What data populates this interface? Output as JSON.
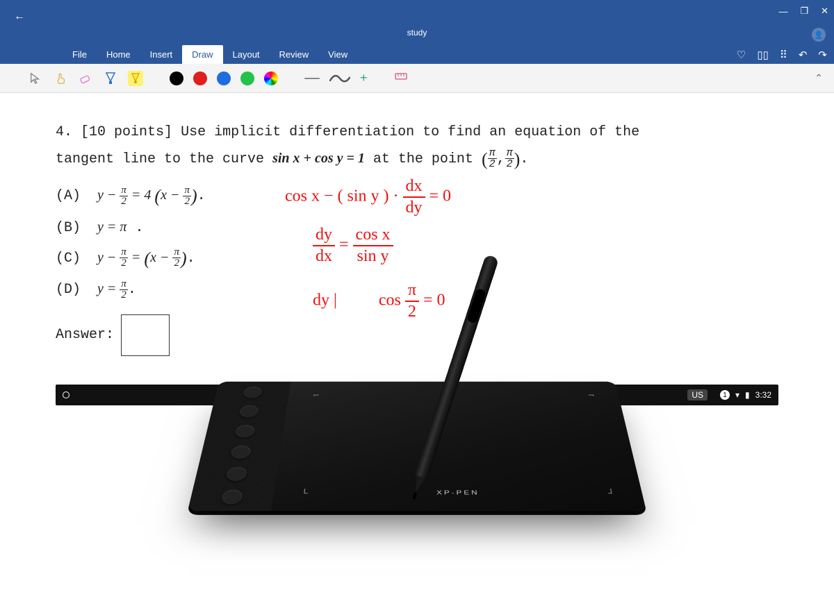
{
  "titlebar": {
    "doc_title": "study",
    "win": {
      "minimize": "—",
      "maximize": "❐",
      "close": "✕"
    }
  },
  "tabs": {
    "items": [
      "File",
      "Home",
      "Insert",
      "Draw",
      "Layout",
      "Review",
      "View"
    ],
    "active_index": 3,
    "right_icons": {
      "tips": "💡",
      "reading": "▢",
      "share": "⚘",
      "undo": "↶",
      "redo": "↷"
    }
  },
  "toolbar": {
    "tools": {
      "select": "▭",
      "touch": "👆",
      "eraser": "◇",
      "pen1": "▽",
      "highlighter": "▽"
    },
    "colors": {
      "black": "#000000",
      "red": "#e11d1d",
      "blue": "#1d6fe1",
      "green": "#23c24a",
      "rainbow": "rainbow"
    },
    "plus": "+"
  },
  "question": {
    "number": "4.",
    "points": "[10 points]",
    "stem_a": "Use implicit differentiation to find an equation of the",
    "stem_b": "tangent line to the curve",
    "equation": "sin x + cos y = 1",
    "stem_c": "at the point",
    "point_num_x": "π",
    "point_den_x": "2",
    "point_num_y": "π",
    "point_den_y": "2",
    "options": {
      "A_label": "(A)",
      "A_lhs_n": "π",
      "A_lhs_d": "2",
      "A_coeff": "4",
      "A_rhs_n": "π",
      "A_rhs_d": "2",
      "B_label": "(B)",
      "B_rhs": "π",
      "C_label": "(C)",
      "C_lhs_n": "π",
      "C_lhs_d": "2",
      "C_rhs_n": "π",
      "C_rhs_d": "2",
      "D_label": "(D)",
      "D_n": "π",
      "D_d": "2"
    },
    "answer_label": "Answer:"
  },
  "handwriting": {
    "line1_a": "cos x − ( sin y ) ·",
    "line1_frac_n": "dx",
    "line1_frac_d": "dy",
    "line1_b": " = 0",
    "line2_lhs_n": "dy",
    "line2_lhs_d": "dx",
    "line2_eq": " = ",
    "line2_rhs_n": "cos x",
    "line2_rhs_d": "sin y",
    "line3_a": "dy |",
    "line3_b": "cos",
    "line3_frac_n": "π",
    "line3_frac_d": "2",
    "line3_c": " = 0"
  },
  "statusbar": {
    "lang": "US",
    "badge": "1",
    "time": "3:32"
  },
  "tablet": {
    "brand": "XP-PEN"
  }
}
